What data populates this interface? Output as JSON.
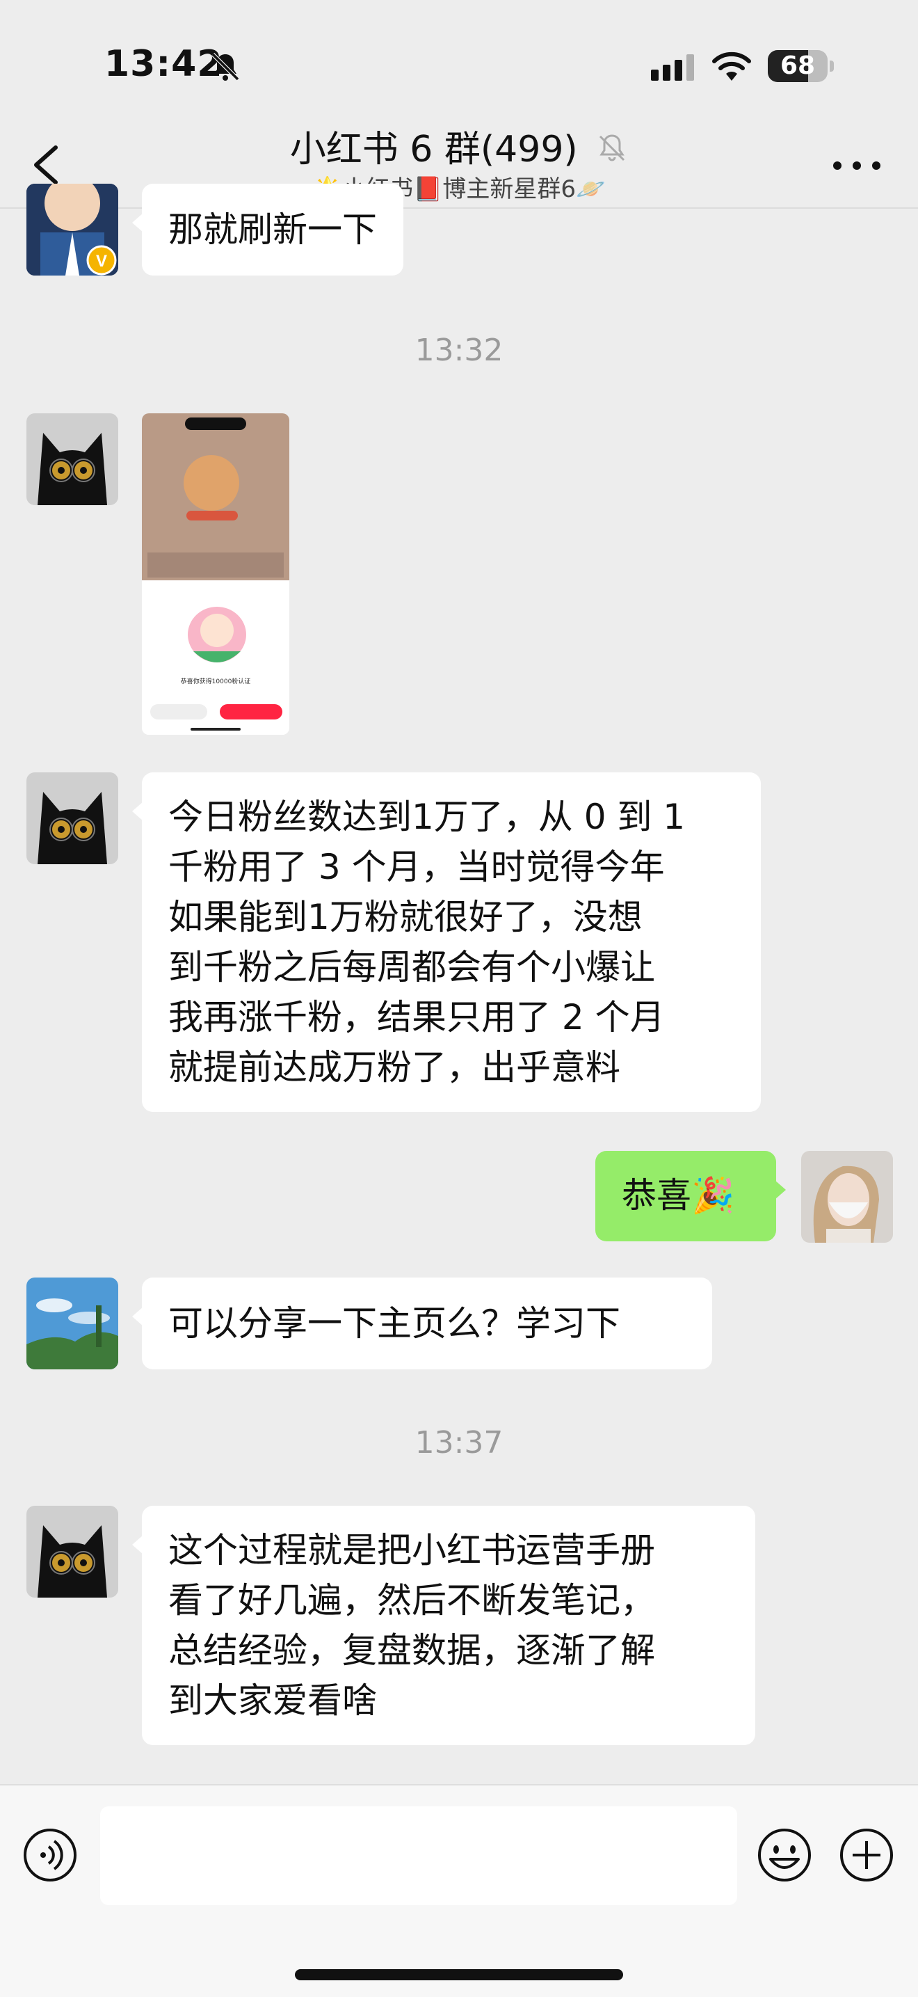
{
  "status_bar": {
    "time": "13:42",
    "battery": "68",
    "battery_level_percent": 68
  },
  "header": {
    "title": "小红书 6 群",
    "member_count": "(499)",
    "subtitle": "🌟小红书📕博主新星群6🪐"
  },
  "messages": [
    {
      "type": "text",
      "sender": "left",
      "text": "那就刷新一下"
    },
    {
      "type": "time",
      "text": "13:32"
    },
    {
      "type": "image",
      "sender": "left",
      "caption": "恭喜你获得10000粉认证"
    },
    {
      "type": "text",
      "sender": "left",
      "lines": [
        "今日粉丝数达到1万了，从 0 到 1",
        "千粉用了 3 个月，当时觉得今年",
        "如果能到1万粉就很好了，没想",
        "到千粉之后每周都会有个小爆让",
        "我再涨千粉，结果只用了 2 个月",
        "就提前达成万粉了，出乎意料"
      ]
    },
    {
      "type": "text",
      "sender": "right",
      "text": "恭喜🎉"
    },
    {
      "type": "text",
      "sender": "left",
      "text": "可以分享一下主页么？学习下"
    },
    {
      "type": "time",
      "text": "13:37"
    },
    {
      "type": "text",
      "sender": "left",
      "lines": [
        "这个过程就是把小红书运营手册",
        "看了好几遍，然后不断发笔记，",
        "总结经验，复盘数据，逐渐了解",
        "到大家爱看啥"
      ]
    }
  ],
  "colors": {
    "background": "#ededed",
    "bubble_self": "#95ec69",
    "bubble_other": "#ffffff",
    "timestamp": "#9a9a9a"
  },
  "icons": [
    "back-arrow-icon",
    "mute-bell-icon",
    "more-icon",
    "voice-icon",
    "emoji-icon",
    "plus-icon"
  ]
}
